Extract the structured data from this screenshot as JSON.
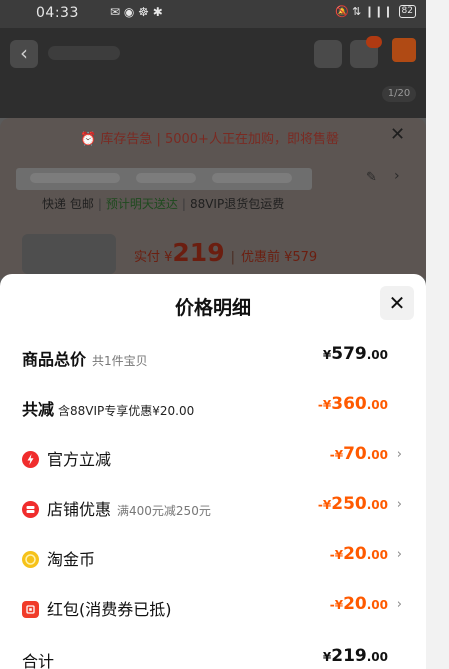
{
  "status_bar": {
    "time": "04:33",
    "left_icons": "✉ ◉ ☸ ✱",
    "right_icons": "🔕 ⇅ ❙❙❙",
    "battery": "82"
  },
  "background": {
    "image_counter": "1/20",
    "stock_alert": "⏰ 库存告急 | 5000+人正在加购，即将售罄",
    "shipping": {
      "free": "快递 包邮",
      "tomorrow": "预计明天送达",
      "return": "88VIP退货包运费"
    },
    "price": {
      "prefix": "实付 ¥",
      "value": "219",
      "before": "优惠前 ¥579"
    }
  },
  "sheet": {
    "title": "价格明细",
    "rows": [
      {
        "label": "商品总价",
        "sub": "共1件宝贝",
        "currency": "¥",
        "int": "579",
        "dec": ".00"
      },
      {
        "label": "共减",
        "sub": "含88VIP专享优惠¥20.00",
        "currency": "-¥",
        "int": "360",
        "dec": ".00"
      },
      {
        "label": "官方立减",
        "sub": "",
        "currency": "-¥",
        "int": "70",
        "dec": ".00",
        "icon": "bolt-icon"
      },
      {
        "label": "店铺优惠",
        "sub": "满400元减250元",
        "currency": "-¥",
        "int": "250",
        "dec": ".00",
        "icon": "store-icon"
      },
      {
        "label": "淘金币",
        "sub": "",
        "currency": "-¥",
        "int": "20",
        "dec": ".00",
        "icon": "coin-icon"
      },
      {
        "label": "红包(消费券已抵)",
        "sub": "",
        "currency": "-¥",
        "int": "20",
        "dec": ".00",
        "icon": "red-packet-icon"
      },
      {
        "label": "合计",
        "sub": "",
        "currency": "¥",
        "int": "219",
        "dec": ".00"
      }
    ],
    "arrow": "›"
  },
  "colors": {
    "accent": "#ff5a00",
    "sheet_bg": "#ffffff",
    "dim_bg": "#5a5a5a"
  }
}
